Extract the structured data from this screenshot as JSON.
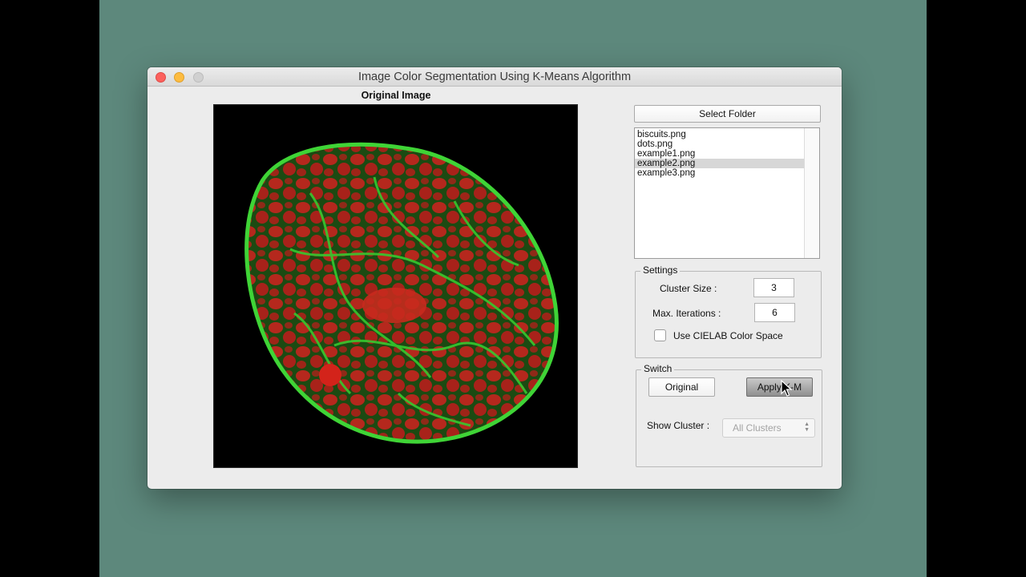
{
  "window": {
    "title": "Image Color Segmentation Using K-Means Algorithm"
  },
  "axes": {
    "title": "Original Image"
  },
  "file_browser": {
    "select_folder_label": "Select Folder",
    "files": [
      "biscuits.png",
      "dots.png",
      "example1.png",
      "example2.png",
      "example3.png"
    ],
    "selected_file": "example2.png"
  },
  "settings": {
    "title": "Settings",
    "cluster_size_label": "Cluster Size :",
    "cluster_size_value": "3",
    "max_iterations_label": "Max. Iterations :",
    "max_iterations_value": "6",
    "cielab_label": "Use CIELAB Color Space",
    "cielab_checked": false
  },
  "switch": {
    "title": "Switch",
    "original_label": "Original",
    "apply_label": "Apply K-M",
    "show_cluster_label": "Show Cluster :",
    "show_cluster_value": "All Clusters"
  },
  "colors": {
    "desktop": "#5d887c",
    "window_bg": "#ececec",
    "cell_green": "#2fbf2a",
    "cell_red": "#c0201a"
  },
  "icons": {
    "close": "close-traffic-light-icon",
    "minimize": "minimize-traffic-light-icon",
    "zoom": "zoom-traffic-light-icon",
    "cursor": "mouse-pointer-icon",
    "popup_arrows": "up-down-arrows-icon"
  }
}
